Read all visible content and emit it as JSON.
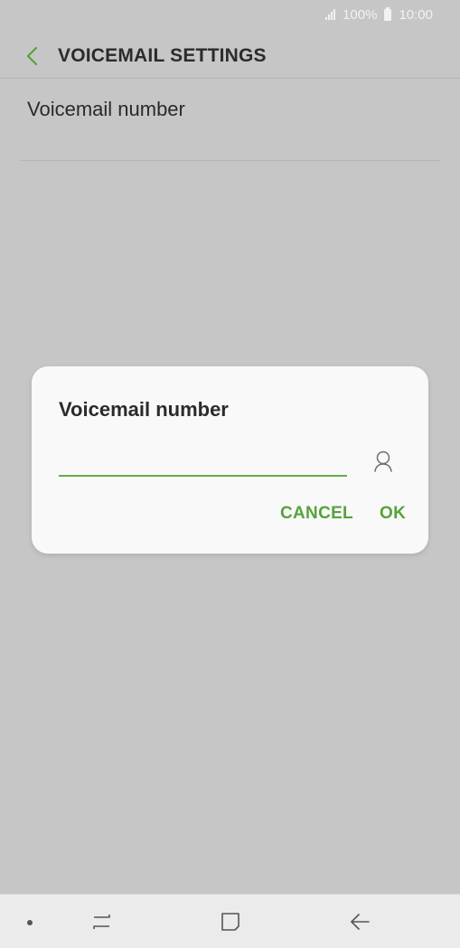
{
  "status_bar": {
    "battery": "100%",
    "time": "10:00"
  },
  "header": {
    "title": "VOICEMAIL SETTINGS",
    "back_icon": "chevron-left-icon"
  },
  "list": {
    "items": [
      {
        "label": "Voicemail number"
      }
    ]
  },
  "dialog": {
    "title": "Voicemail number",
    "input_value": "",
    "contact_icon": "contact-icon",
    "cancel_label": "CANCEL",
    "ok_label": "OK"
  },
  "nav_bar": {
    "icons": [
      "dot-icon",
      "recent-apps-icon",
      "home-icon",
      "back-arrow-icon"
    ]
  },
  "colors": {
    "accent": "#58a23c",
    "background": "#c6c6c6",
    "dialog": "#f9f9f9",
    "nav_bar": "#ebebeb"
  }
}
